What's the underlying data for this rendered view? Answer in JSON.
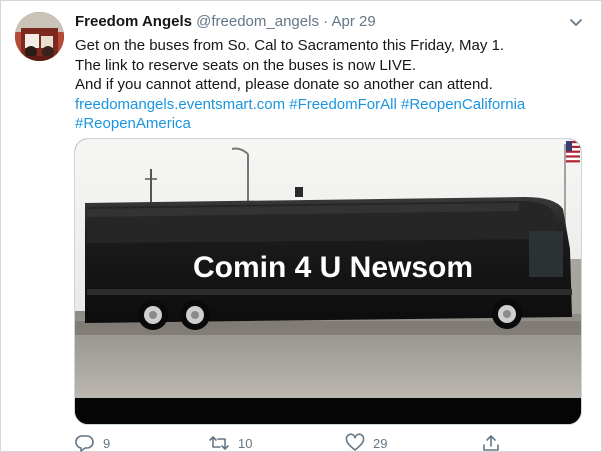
{
  "tweet": {
    "display_name": "Freedom Angels",
    "handle": "@freedom_angels",
    "separator": "·",
    "date": "Apr 29",
    "text_lines": [
      "Get on the buses from So. Cal to Sacramento this Friday, May 1.",
      "The link to reserve seats on the buses is now LIVE.",
      "And if you cannot attend, please donate so another can attend."
    ],
    "links": {
      "url": "freedomangels.eventsmart.com",
      "hashtag_1": "#FreedomForAll",
      "hashtag_2": "#ReopenCalifornia",
      "hashtag_3": "#ReopenAmerica"
    },
    "media": {
      "overlay_text": "Comin 4 U Newsom"
    },
    "actions": {
      "reply_count": "9",
      "retweet_count": "10",
      "like_count": "29"
    }
  },
  "icons": {
    "caret": "chevron-down-icon",
    "reply": "reply-icon",
    "retweet": "retweet-icon",
    "like": "heart-icon",
    "share": "share-icon"
  },
  "colors": {
    "link": "#1b95e0",
    "secondary_text": "#657786",
    "primary_text": "#14171a"
  }
}
